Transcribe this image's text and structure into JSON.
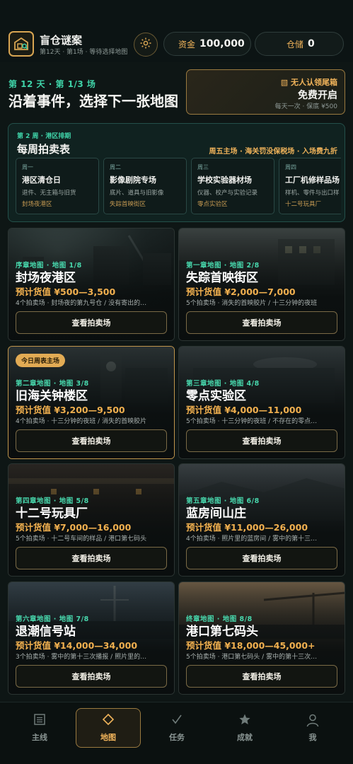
{
  "header": {
    "title": "盲仓谜案",
    "subtitle": "第12天 · 第1场 · 等待选择地图",
    "funds_label": "资金",
    "funds_value": "100,000",
    "storage_label": "仓储",
    "storage_value": "0"
  },
  "progress": {
    "day_line": "第 12 天 · 第 1/3 场",
    "headline": "沿着事件，选择下一张地图"
  },
  "free_offer": {
    "top": "▧ 无人认领尾箱",
    "main": "免费开启",
    "sub": "每天一次 · 保底 ¥500"
  },
  "weekly": {
    "tag": "第 2 周 · 港区排期",
    "title": "每周拍卖表",
    "note": "周五主场 · 海关罚没保税场 · 入场费九折",
    "days": [
      {
        "day": "周一",
        "title": "港区清仓日",
        "desc": "退件、无主箱与旧货",
        "loc": "封场夜港区"
      },
      {
        "day": "周二",
        "title": "影像剧院专场",
        "desc": "底片、道具与旧影像",
        "loc": "失踪首映街区"
      },
      {
        "day": "周三",
        "title": "学校实验器材场",
        "desc": "仪器、校产与实验记录",
        "loc": "零点实验区"
      },
      {
        "day": "周四",
        "title": "工厂机修样品场",
        "desc": "样机、零件与出口样",
        "loc": "十二号玩具厂"
      }
    ]
  },
  "maps": [
    {
      "chapter": "序章地图 · 地图 1/8",
      "name": "封场夜港区",
      "value": "预计货值 ¥500—3,500",
      "desc": "4个拍卖场 · 封场夜的第九号仓 / 没有寄出的…",
      "button": "查看拍卖场",
      "badge": ""
    },
    {
      "chapter": "第一章地图 · 地图 2/8",
      "name": "失踪首映街区",
      "value": "预计货值 ¥2,000—7,000",
      "desc": "5个拍卖场 · 消失的首映胶片 / 十三分钟的夜班",
      "button": "查看拍卖场",
      "badge": ""
    },
    {
      "chapter": "第二章地图 · 地图 3/8",
      "name": "旧海关钟楼区",
      "value": "预计货值 ¥3,200—9,500",
      "desc": "4个拍卖场 · 十三分钟的夜班 / 消失的首映胶片",
      "button": "查看拍卖场",
      "badge": "今日周表主场"
    },
    {
      "chapter": "第三章地图 · 地图 4/8",
      "name": "零点实验区",
      "value": "预计货值 ¥4,000—11,000",
      "desc": "5个拍卖场 · 十三分钟的夜班 / 不存在的零点…",
      "button": "查看拍卖场",
      "badge": ""
    },
    {
      "chapter": "第四章地图 · 地图 5/8",
      "name": "十二号玩具厂",
      "value": "预计货值 ¥7,000—16,000",
      "desc": "5个拍卖场 · 十二号车间的样品 / 港口第七码头",
      "button": "查看拍卖场",
      "badge": ""
    },
    {
      "chapter": "第五章地图 · 地图 6/8",
      "name": "蓝房间山庄",
      "value": "预计货值 ¥11,000—26,000",
      "desc": "4个拍卖场 · 照片里的蓝房间 / 雾中的第十三…",
      "button": "查看拍卖场",
      "badge": ""
    },
    {
      "chapter": "第六章地图 · 地图 7/8",
      "name": "退潮信号站",
      "value": "预计货值 ¥14,000—34,000",
      "desc": "3个拍卖场 · 雾中的第十三次播报 / 照片里的…",
      "button": "查看拍卖场",
      "badge": ""
    },
    {
      "chapter": "终章地图 · 地图 8/8",
      "name": "港口第七码头",
      "value": "预计货值 ¥18,000—45,000+",
      "desc": "5个拍卖场 · 港口第七码头 / 雾中的第十三次…",
      "button": "查看拍卖场",
      "badge": ""
    }
  ],
  "nav": [
    {
      "label": "主线",
      "icon": "list-icon"
    },
    {
      "label": "地图",
      "icon": "diamond-icon"
    },
    {
      "label": "任务",
      "icon": "check-icon"
    },
    {
      "label": "成就",
      "icon": "star-icon"
    },
    {
      "label": "我",
      "icon": "person-icon"
    }
  ],
  "colors": {
    "accent_gold": "#f0b35a",
    "accent_teal": "#3fd3a8",
    "background": "#0e1615"
  }
}
